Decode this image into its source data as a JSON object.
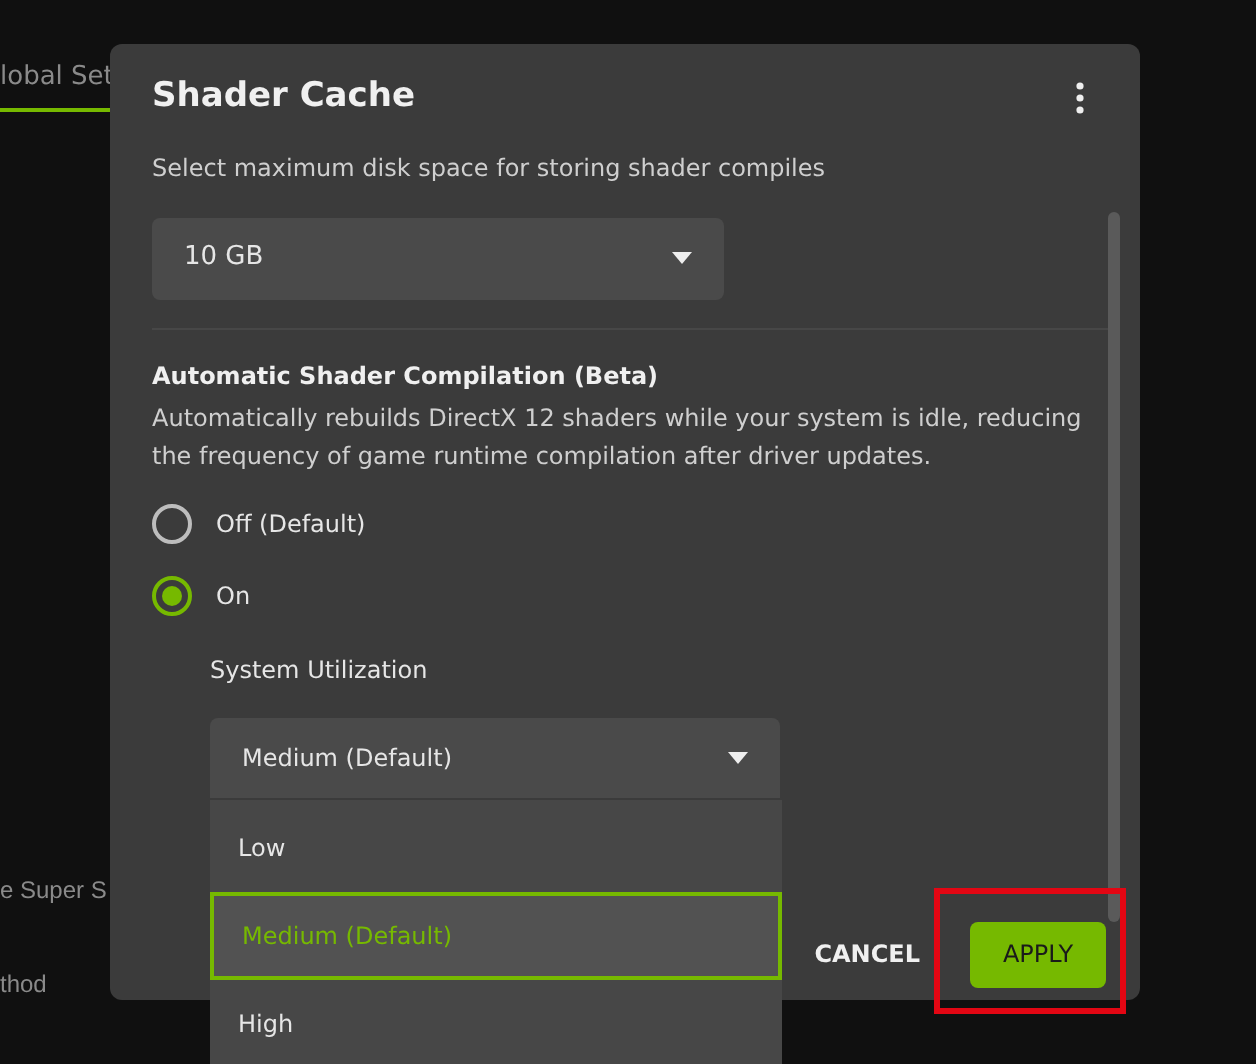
{
  "background": {
    "tab": {
      "label": "lobal Set",
      "selected": true
    },
    "labels": [
      "e Super S",
      "thod"
    ]
  },
  "dialog": {
    "title": "Shader Cache",
    "description": "Select maximum disk space for storing shader compiles",
    "disk_space": {
      "value": "10 GB"
    },
    "section": {
      "heading": "Automatic Shader Compilation (Beta)",
      "description": "Automatically rebuilds DirectX 12 shaders while your system is idle, reducing the frequency of game runtime compilation after driver updates."
    },
    "options": [
      {
        "label": "Off (Default)",
        "selected": false
      },
      {
        "label": "On",
        "selected": true
      }
    ],
    "utilization": {
      "label": "System Utilization",
      "value": "Medium (Default)",
      "expanded": true,
      "items": [
        {
          "label": "Low",
          "selected": false
        },
        {
          "label": "Medium (Default)",
          "selected": true
        },
        {
          "label": "High",
          "selected": false
        }
      ]
    },
    "buttons": [
      {
        "label": "CANCEL",
        "kind": "text"
      },
      {
        "label": "APPLY",
        "kind": "primary",
        "highlighted": true
      }
    ]
  }
}
